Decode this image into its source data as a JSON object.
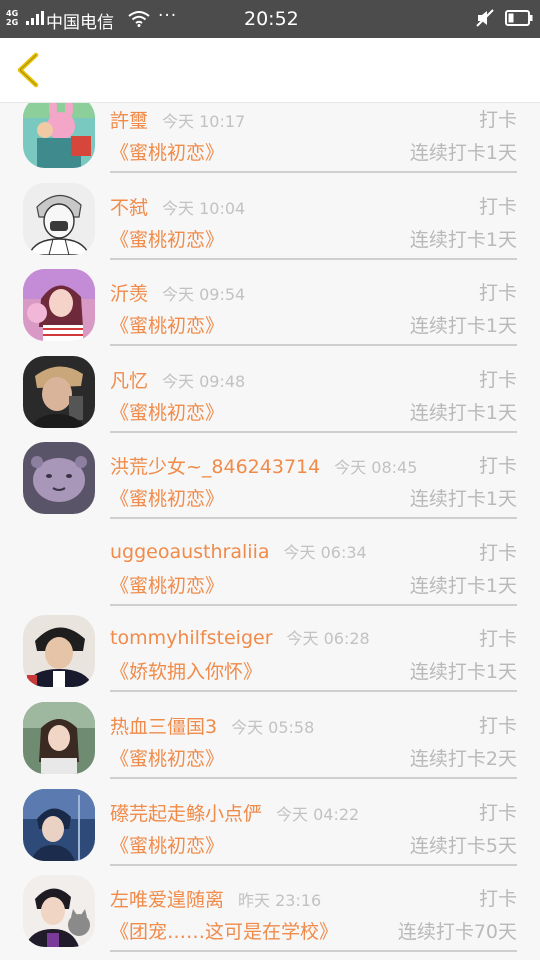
{
  "status_bar": {
    "network_top": "4G",
    "network_bottom": "2G",
    "carrier": "中国电信",
    "dots": "···",
    "time": "20:52"
  },
  "nav": {
    "back_icon": "chevron-left-icon",
    "accent_color": "#e8c100"
  },
  "colors": {
    "name": "#f08b4a",
    "meta": "#c2c2c2",
    "muted": "#b9b9b9"
  },
  "records": [
    {
      "name": "許璽",
      "time": "今天 10:17",
      "action": "打卡",
      "book": "《蜜桃初恋》",
      "streak": "连续打卡1天",
      "avatar": "avatar-pink-bunny"
    },
    {
      "name": "不弑",
      "time": "今天 10:04",
      "action": "打卡",
      "book": "《蜜桃初恋》",
      "streak": "连续打卡1天",
      "avatar": "avatar-sketch-boy"
    },
    {
      "name": "沂羡",
      "time": "今天 09:54",
      "action": "打卡",
      "book": "《蜜桃初恋》",
      "streak": "连续打卡1天",
      "avatar": "avatar-pink-girl"
    },
    {
      "name": "凡忆",
      "time": "今天 09:48",
      "action": "打卡",
      "book": "《蜜桃初恋》",
      "streak": "连续打卡1天",
      "avatar": "avatar-dark-boy"
    },
    {
      "name": "洪荒少女~_846243714",
      "time": "今天 08:45",
      "action": "打卡",
      "book": "《蜜桃初恋》",
      "streak": "连续打卡1天",
      "avatar": "avatar-purple-cartoon"
    },
    {
      "name": "uggeoausthraliia",
      "time": "今天 06:34",
      "action": "打卡",
      "book": "《蜜桃初恋》",
      "streak": "连续打卡1天",
      "avatar": ""
    },
    {
      "name": "tommyhilfsteiger",
      "time": "今天 06:28",
      "action": "打卡",
      "book": "《娇软拥入你怀》",
      "streak": "连续打卡1天",
      "avatar": "avatar-jacket-boy"
    },
    {
      "name": "热血三僵国3",
      "time": "今天 05:58",
      "action": "打卡",
      "book": "《蜜桃初恋》",
      "streak": "连续打卡2天",
      "avatar": "avatar-green-girl"
    },
    {
      "name": "礤芫起走鲦小点俨",
      "time": "今天 04:22",
      "action": "打卡",
      "book": "《蜜桃初恋》",
      "streak": "连续打卡5天",
      "avatar": "avatar-blue-anime"
    },
    {
      "name": "左唯爱遑随离",
      "time": "昨天 23:16",
      "action": "打卡",
      "book": "《团宠……这可是在学校》",
      "streak": "连续打卡70天",
      "avatar": "avatar-cat-boy"
    }
  ]
}
